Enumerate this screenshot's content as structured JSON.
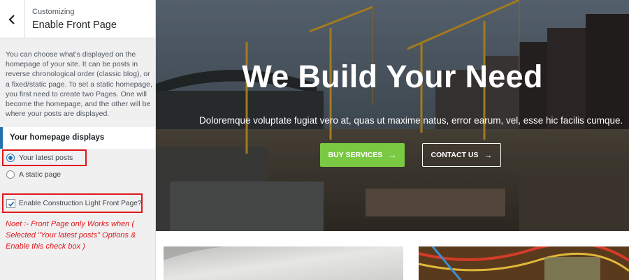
{
  "sidebar": {
    "back_icon": "chevron-left-icon",
    "breadcrumb": "Customizing",
    "title": "Enable Front Page",
    "description": "You can choose what’s displayed on the homepage of your site. It can be posts in reverse chronological order (classic blog), or a fixed/static page. To set a static homepage, you first need to create two Pages. One will become the homepage, and the other will be where your posts are displayed.",
    "section_heading": "Your homepage displays",
    "options": [
      {
        "label": "Your latest posts",
        "checked": true
      },
      {
        "label": "A static page",
        "checked": false
      }
    ],
    "checkbox_label": "Enable Construction Light Front Page?",
    "checkbox_checked": true,
    "note": "Noet :- Front Page only Works when ( Selected \"Your latest posts\" Options & Enable this check box )",
    "highlight_color": "#e0171a",
    "accent_color": "#2271b1"
  },
  "preview": {
    "hero_title": "We Build Your Need",
    "hero_subtitle": "Doloremque voluptate fugiat vero at, quas ut maxime natus, error earum, vel, esse hic facilis cumque...",
    "buttons": {
      "services_label": "BUY SERVICES",
      "contact_label": "CONTACT US",
      "services_color": "#7ac943"
    }
  }
}
